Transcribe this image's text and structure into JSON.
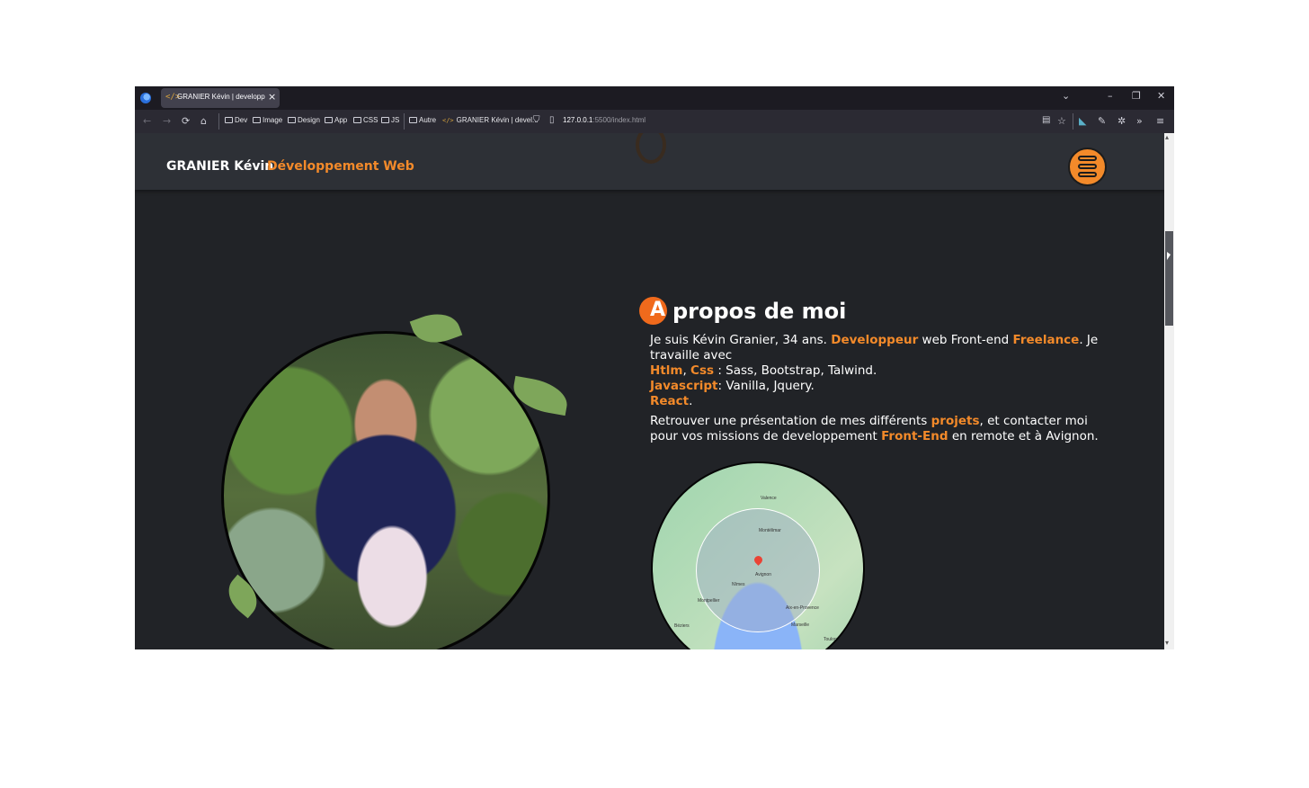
{
  "browser": {
    "tab": {
      "title": "GRANIER Kévin | developpeur w",
      "favicon": "code-icon"
    },
    "window_controls": {
      "list_tabs": "⌄",
      "minimize": "–",
      "restore": "❐",
      "close": "✕"
    },
    "nav": {
      "back": "←",
      "forward": "→",
      "reload": "⟳",
      "home": "⌂"
    },
    "bookmarks": [
      "Dev",
      "Image",
      "Design",
      "App",
      "CSS",
      "JS",
      "Autre",
      "GRANIER Kévin | devel..."
    ],
    "url": {
      "host": "127.0.0.1",
      "path": ":5500/index.html"
    },
    "extensions": [
      "reader-icon",
      "star-icon",
      "extension-icon",
      "eyedropper-icon",
      "settings-icon",
      "overflow-icon",
      "menu-icon"
    ]
  },
  "header": {
    "name": "GRANIER Kévin",
    "role": "Développement Web"
  },
  "about": {
    "title_letter": "A",
    "title_rest": "propos de moi",
    "p1": {
      "t1": "Je suis Kévin Granier, 34 ans. ",
      "h1": "Developpeur",
      "t2": " web Front-end ",
      "h2": "Freelance",
      "t3": ". Je travaille avec"
    },
    "stack": {
      "htlm": "Htlm",
      "sep1": ", ",
      "css": "Css",
      "css_detail": " : Sass, Bootstrap, Talwind.",
      "js": "Javascript",
      "js_detail": ": Vanilla, Jquery.",
      "react": "React",
      "react_end": "."
    },
    "p2": {
      "t1": "Retrouver une présentation de mes différents ",
      "h1": "projets",
      "t2": ", et contacter moi pour vos missions de developpement ",
      "h2": "Front-End",
      "t3": " en remote et à Avignon."
    },
    "map_labels": [
      "Valence",
      "Montélimar",
      "Avignon",
      "Nîmes",
      "Montpellier",
      "Aix-en-Provence",
      "Marseille",
      "Béziers",
      "Toulon"
    ]
  },
  "colors": {
    "accent": "#f38a2a",
    "page_bg": "#212327",
    "header_bg": "#2d3036"
  }
}
